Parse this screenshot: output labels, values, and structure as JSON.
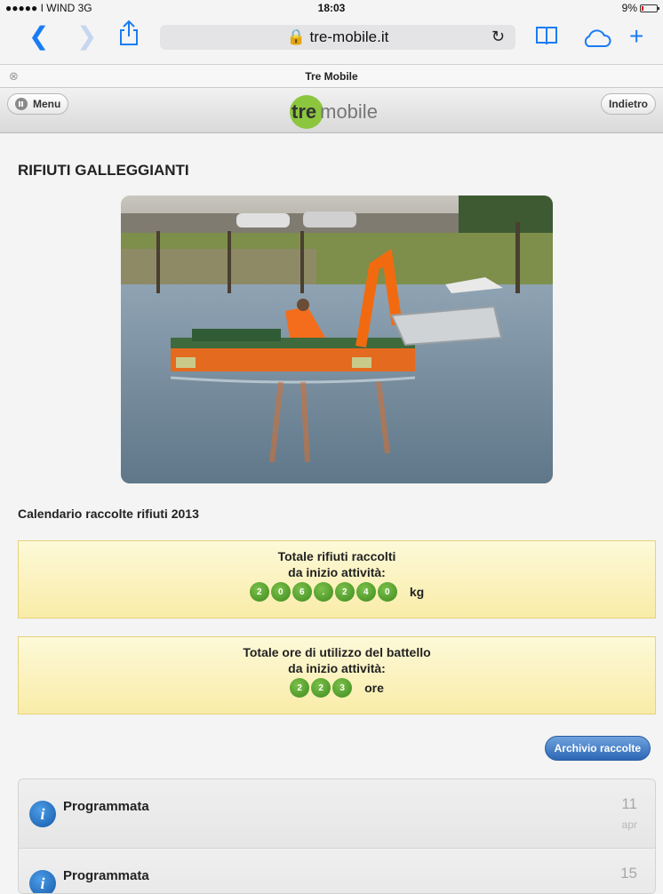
{
  "status_bar": {
    "carrier": "●●●●● I WIND  3G",
    "time": "18:03",
    "battery": "9%"
  },
  "browser": {
    "url": "tre-mobile.it",
    "tab_title": "Tre Mobile"
  },
  "site_header": {
    "menu_label": "Menu",
    "back_label": "Indietro",
    "logo_tre": "tre",
    "logo_mobile": "mobile"
  },
  "page": {
    "title": "RIFIUTI GALLEGGIANTI",
    "calendar_title": "Calendario raccolte rifiuti 2013"
  },
  "counter_waste": {
    "line1": "Totale rifiuti raccolti",
    "line2": "da inizio attività:",
    "digits": [
      "2",
      "0",
      "6",
      ".",
      "2",
      "4",
      "0"
    ],
    "unit": "kg"
  },
  "counter_hours": {
    "line1": "Totale ore di utilizzo del battello",
    "line2": "da inizio attività:",
    "digits": [
      "2",
      "2",
      "3"
    ],
    "unit": "ore"
  },
  "archive_button": "Archivio raccolte",
  "events": [
    {
      "label": "Programmata",
      "day": "11",
      "month": "apr"
    },
    {
      "label": "Programmata",
      "day": "15",
      "month": ""
    }
  ],
  "colors": {
    "accent_blue": "#1a7cf5",
    "logo_green": "#8cc63f",
    "digit_green": "#4e9c2b",
    "counter_bg": "#fbf2bd"
  }
}
